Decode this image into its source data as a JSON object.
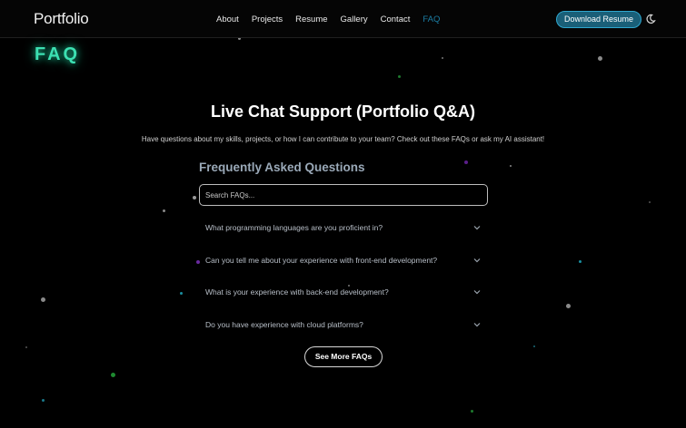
{
  "header": {
    "brand": "Portfolio",
    "nav": [
      "About",
      "Projects",
      "Resume",
      "Gallery",
      "Contact",
      "FAQ"
    ],
    "active_nav": "FAQ",
    "download_label": "Download Resume",
    "theme_icon": "moon-icon"
  },
  "badge": "FAQ",
  "main": {
    "title": "Live Chat Support (Portfolio Q&A)",
    "subtitle": "Have questions about my skills, projects, or how I can contribute to your team? Check out these FAQs or ask my AI assistant!",
    "section_heading": "Frequently Asked Questions",
    "search_placeholder": "Search FAQs...",
    "faqs": [
      "What programming languages are you proficient in?",
      "Can you tell me about your experience with front-end development?",
      "What is your experience with back-end development?",
      "Do you have experience with cloud platforms?"
    ],
    "more_label": "See More FAQs"
  },
  "colors": {
    "accent": "#1c7fa6",
    "badge_glow": "#3ce0b2",
    "button_fill": "#1a5f78"
  }
}
